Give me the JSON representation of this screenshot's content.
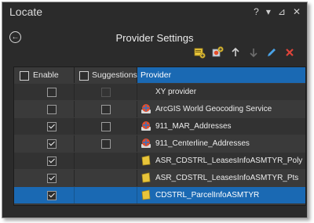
{
  "window": {
    "title": "Locate",
    "controls": [
      "?",
      "▾",
      "⊿",
      "✕"
    ]
  },
  "page": {
    "title": "Provider Settings",
    "back_icon": "back-arrow-icon"
  },
  "toolbar": {
    "buttons": [
      {
        "name": "add-locator-button",
        "icon": "add-locator-icon"
      },
      {
        "name": "add-service-button",
        "icon": "add-service-icon"
      },
      {
        "name": "move-up-button",
        "icon": "arrow-up-icon"
      },
      {
        "name": "move-down-button",
        "icon": "arrow-down-icon"
      },
      {
        "name": "edit-button",
        "icon": "pencil-icon"
      },
      {
        "name": "remove-button",
        "icon": "red-x-icon"
      }
    ]
  },
  "grid": {
    "columns": {
      "enable": "Enable",
      "suggestions": "Suggestions",
      "provider": "Provider"
    },
    "rows": [
      {
        "provider": "XY provider",
        "icon": "none",
        "enabled": false,
        "suggestions": false,
        "suggestions_enabled": false
      },
      {
        "provider": "ArcGIS World Geocoding Service",
        "icon": "globe-locator-icon",
        "enabled": false,
        "suggestions": false,
        "suggestions_enabled": true
      },
      {
        "provider": "911_MAR_Addresses",
        "icon": "globe-locator-icon",
        "enabled": true,
        "suggestions": false,
        "suggestions_enabled": true
      },
      {
        "provider": "911_Centerline_Addresses",
        "icon": "globe-locator-icon",
        "enabled": true,
        "suggestions": false,
        "suggestions_enabled": true
      },
      {
        "provider": "ASR_CDSTRL_LeasesInfoASMTYR_Poly",
        "icon": "polygon-layer-icon",
        "enabled": true,
        "suggestions": false,
        "suggestions_enabled": false
      },
      {
        "provider": "ASR_CDSTRL_LeasesInfoASMTYR_Pts",
        "icon": "polygon-layer-icon",
        "enabled": true,
        "suggestions": false,
        "suggestions_enabled": false
      },
      {
        "provider": "CDSTRL_ParcelInfoASMTYR",
        "icon": "polygon-layer-icon",
        "enabled": true,
        "suggestions": false,
        "suggestions_enabled": false,
        "selected": true
      }
    ]
  },
  "colors": {
    "panel_bg": "#2b2b2b",
    "selection": "#1a69b3",
    "remove_red": "#e0443a",
    "edit_blue": "#4aa3e8",
    "layer_yellow": "#e8c53a"
  }
}
